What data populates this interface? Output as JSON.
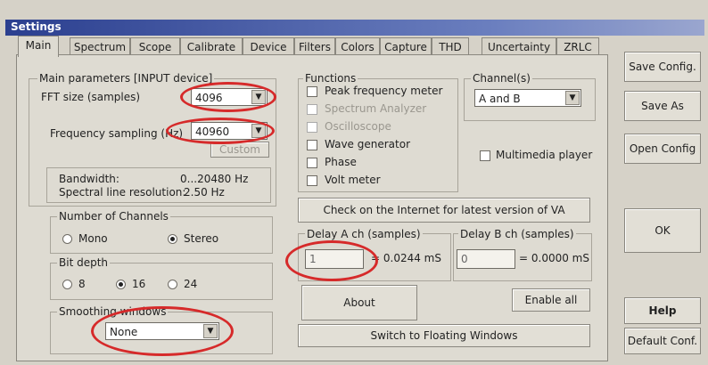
{
  "window": {
    "title": "Settings"
  },
  "tabs": [
    "Main",
    "Spectrum",
    "Scope",
    "Calibrate",
    "Device",
    "Filters",
    "Colors",
    "Capture",
    "THD",
    "Uncertainty",
    "ZRLC"
  ],
  "main_params": {
    "legend": "Main parameters [INPUT device]",
    "fft_label": "FFT size (samples)",
    "fft_value": "4096",
    "fs_label": "Frequency sampling (Hz)",
    "fs_value": "40960",
    "custom_button": "Custom",
    "bandwidth_label": "Bandwidth:",
    "bandwidth_value": "0...20480 Hz",
    "resolution_label": "Spectral line resolution:",
    "resolution_value": "2.50 Hz"
  },
  "channels": {
    "legend": "Number of Channels",
    "mono": "Mono",
    "stereo": "Stereo",
    "selected": "Stereo"
  },
  "bitdepth": {
    "legend": "Bit depth",
    "options": [
      "8",
      "16",
      "24"
    ],
    "selected": "16"
  },
  "smoothing": {
    "legend": "Smoothing windows",
    "value": "None"
  },
  "functions": {
    "legend": "Functions",
    "items": [
      {
        "label": "Peak frequency meter",
        "enabled": true
      },
      {
        "label": "Spectrum Analyzer",
        "enabled": false
      },
      {
        "label": "Oscilloscope",
        "enabled": false
      },
      {
        "label": "Wave generator",
        "enabled": true
      },
      {
        "label": "Phase",
        "enabled": true
      },
      {
        "label": "Volt meter",
        "enabled": true
      }
    ]
  },
  "channel_sel": {
    "legend": "Channel(s)",
    "value": "A and B"
  },
  "multimedia": {
    "label": "Multimedia player"
  },
  "check_button": "Check on the Internet for latest version of VA",
  "delay_a": {
    "legend": "Delay A ch (samples)",
    "value": "1",
    "result": "= 0.0244 mS"
  },
  "delay_b": {
    "legend": "Delay B ch (samples)",
    "value": "0",
    "result": "= 0.0000 mS"
  },
  "about_button": "About",
  "enable_all_button": "Enable all",
  "floating_button": "Switch to Floating Windows",
  "side": {
    "save_config": "Save Config.",
    "save_as": "Save As",
    "open_config": "Open Config",
    "ok": "OK",
    "help": "Help",
    "default_conf": "Default Conf."
  },
  "colors": {
    "highlight": "#d62a2a",
    "title_bar": "#2b3f8f"
  }
}
